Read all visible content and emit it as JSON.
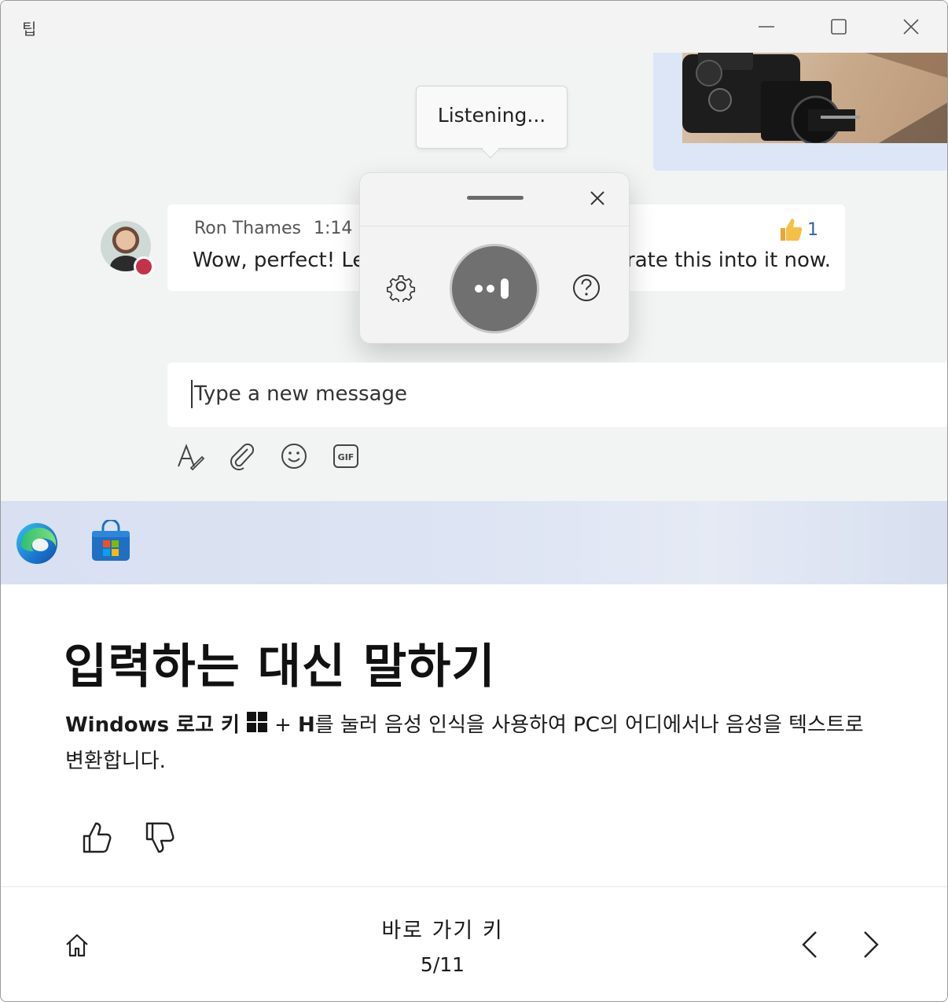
{
  "window": {
    "title": "팁",
    "controls": [
      "minimize-icon",
      "maximize-icon",
      "close-icon"
    ]
  },
  "illustration": {
    "tooltip": "Listening...",
    "message": {
      "sender": "Ron Thames",
      "time": "1:14 P",
      "text_left": "Wow, perfect! Let",
      "text_right": "rate this into it now.",
      "reaction_icon": "thumbs-up-icon",
      "reaction_count": "1"
    },
    "voice_panel": {
      "icons": [
        "settings-icon",
        "microphone-icon",
        "help-icon",
        "close-icon"
      ]
    },
    "compose": {
      "placeholder": "Type a new message"
    },
    "toolbar_icons": [
      "format-icon",
      "attach-icon",
      "emoji-icon",
      "gif-icon"
    ],
    "taskbar_icons": [
      "edge-icon",
      "store-icon"
    ]
  },
  "tip": {
    "title": "입력하는 대신 말하기",
    "body_bold_1": "Windows 로고 키",
    "body_plus": "+",
    "body_bold_2": "H",
    "body_rest": "를 눌러 음성 인식을 사용하여 PC의 어디에서나 음성을 텍스트로 변환합니다."
  },
  "footer": {
    "category": "바로 가기 키",
    "page": "5/11"
  },
  "colors": {
    "presence_busy": "#c4314b",
    "reaction_blue": "#2f5fb3",
    "mic_button": "#707070",
    "taskbar": "#dde4f3"
  }
}
